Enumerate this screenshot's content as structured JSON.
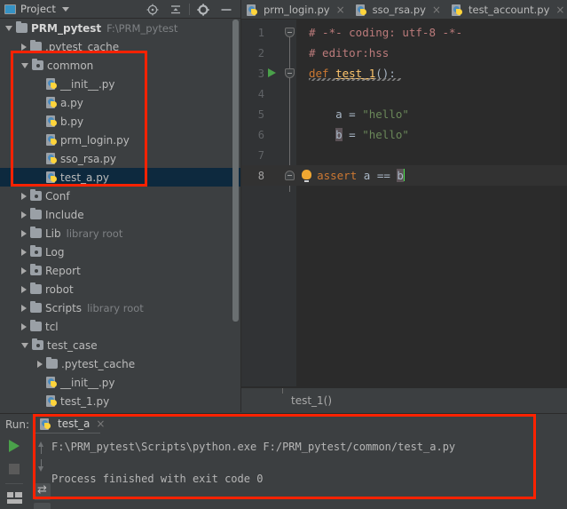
{
  "project_panel": {
    "title": "Project",
    "dropdown_icon": "chevron-down-icon",
    "tools": [
      "locate-icon",
      "collapse-all-icon",
      "settings-gear-icon",
      "minimize-icon"
    ],
    "tree": [
      {
        "depth": 0,
        "twist": "open",
        "icon": "folder",
        "label": "PRM_pytest",
        "sublabel": "F:\\PRM_pytest",
        "bold": true,
        "selected": false
      },
      {
        "depth": 1,
        "twist": "closed",
        "icon": "folder",
        "label": ".pytest_cache",
        "sublabel": "",
        "bold": false,
        "selected": false
      },
      {
        "depth": 1,
        "twist": "open",
        "icon": "folder-src",
        "label": "common",
        "sublabel": "",
        "bold": false,
        "selected": false
      },
      {
        "depth": 2,
        "twist": "none",
        "icon": "python-file",
        "label": "__init__.py",
        "sublabel": "",
        "bold": false,
        "selected": false
      },
      {
        "depth": 2,
        "twist": "none",
        "icon": "python-file",
        "label": "a.py",
        "sublabel": "",
        "bold": false,
        "selected": false
      },
      {
        "depth": 2,
        "twist": "none",
        "icon": "python-file",
        "label": "b.py",
        "sublabel": "",
        "bold": false,
        "selected": false
      },
      {
        "depth": 2,
        "twist": "none",
        "icon": "python-file",
        "label": "prm_login.py",
        "sublabel": "",
        "bold": false,
        "selected": false
      },
      {
        "depth": 2,
        "twist": "none",
        "icon": "python-file",
        "label": "sso_rsa.py",
        "sublabel": "",
        "bold": false,
        "selected": false
      },
      {
        "depth": 2,
        "twist": "none",
        "icon": "python-file",
        "label": "test_a.py",
        "sublabel": "",
        "bold": false,
        "selected": true
      },
      {
        "depth": 1,
        "twist": "closed",
        "icon": "folder-src",
        "label": "Conf",
        "sublabel": "",
        "bold": false,
        "selected": false
      },
      {
        "depth": 1,
        "twist": "closed",
        "icon": "folder",
        "label": "Include",
        "sublabel": "",
        "bold": false,
        "selected": false
      },
      {
        "depth": 1,
        "twist": "closed",
        "icon": "folder",
        "label": "Lib",
        "sublabel": "library root",
        "bold": false,
        "selected": false
      },
      {
        "depth": 1,
        "twist": "closed",
        "icon": "folder-src",
        "label": "Log",
        "sublabel": "",
        "bold": false,
        "selected": false
      },
      {
        "depth": 1,
        "twist": "closed",
        "icon": "folder-src",
        "label": "Report",
        "sublabel": "",
        "bold": false,
        "selected": false
      },
      {
        "depth": 1,
        "twist": "closed",
        "icon": "folder",
        "label": "robot",
        "sublabel": "",
        "bold": false,
        "selected": false
      },
      {
        "depth": 1,
        "twist": "closed",
        "icon": "folder",
        "label": "Scripts",
        "sublabel": "library root",
        "bold": false,
        "selected": false
      },
      {
        "depth": 1,
        "twist": "closed",
        "icon": "folder",
        "label": "tcl",
        "sublabel": "",
        "bold": false,
        "selected": false
      },
      {
        "depth": 1,
        "twist": "open",
        "icon": "folder-src",
        "label": "test_case",
        "sublabel": "",
        "bold": false,
        "selected": false
      },
      {
        "depth": 2,
        "twist": "closed",
        "icon": "folder",
        "label": ".pytest_cache",
        "sublabel": "",
        "bold": false,
        "selected": false
      },
      {
        "depth": 2,
        "twist": "none",
        "icon": "python-file",
        "label": "__init__.py",
        "sublabel": "",
        "bold": false,
        "selected": false
      },
      {
        "depth": 2,
        "twist": "none",
        "icon": "python-file",
        "label": "test_1.py",
        "sublabel": "",
        "bold": false,
        "selected": false
      }
    ]
  },
  "editor": {
    "tabs": [
      {
        "label": "prm_login.py",
        "icon": "python-file",
        "close": "×",
        "active": false
      },
      {
        "label": "sso_rsa.py",
        "icon": "python-file",
        "close": "×",
        "active": false
      },
      {
        "label": "test_account.py",
        "icon": "python-file",
        "close": "×",
        "active": false
      }
    ],
    "lines": [
      {
        "num": "1",
        "text": "# -*- coding: utf-8 -*-",
        "kind": "comment",
        "fold": "start",
        "runnable": false,
        "bulb": false,
        "current": false
      },
      {
        "num": "2",
        "text": "# editor:hss",
        "kind": "comment",
        "fold": "mid",
        "runnable": false,
        "bulb": false,
        "current": false
      },
      {
        "num": "3",
        "text": "def test_1():",
        "kind": "def",
        "fold": "start",
        "runnable": true,
        "bulb": false,
        "current": false
      },
      {
        "num": "4",
        "text": "",
        "kind": "plain",
        "fold": "none",
        "runnable": false,
        "bulb": false,
        "current": false
      },
      {
        "num": "5",
        "text": "    a = \"hello\"",
        "kind": "assign_a",
        "fold": "none",
        "runnable": false,
        "bulb": false,
        "current": false
      },
      {
        "num": "6",
        "text": "    b = \"hello\"",
        "kind": "assign_b",
        "fold": "none",
        "runnable": false,
        "bulb": false,
        "current": false
      },
      {
        "num": "7",
        "text": "",
        "kind": "plain",
        "fold": "none",
        "runnable": false,
        "bulb": false,
        "current": false
      },
      {
        "num": "8",
        "text": "    assert a == b",
        "kind": "assert",
        "fold": "end",
        "runnable": false,
        "bulb": true,
        "current": true
      }
    ],
    "code_tokens": {
      "comment1": "# -*- coding: utf-8 -*-",
      "comment2": "# editor:hss",
      "kw_def": "def",
      "fn_name": "test_1",
      "fn_parens": "():",
      "var_a": "a",
      "var_b": "b",
      "eq": "=",
      "str_hello": "\"hello\"",
      "kw_assert": "assert",
      "op_eqeq": "=="
    },
    "breadcrumb": "test_1()"
  },
  "run_panel": {
    "label": "Run:",
    "tab": {
      "label": "test_a",
      "icon": "python-file",
      "close": "×"
    },
    "sidebar_icons": [
      "run-icon",
      "stop-icon",
      "layout-icon"
    ],
    "gutter_icons": [
      "scroll-up-icon",
      "scroll-down-icon",
      "soft-wrap-icon",
      "print-icon"
    ],
    "output": [
      "F:\\PRM_pytest\\Scripts\\python.exe F:/PRM_pytest/common/test_a.py",
      "",
      "Process finished with exit code 0"
    ]
  },
  "annotations": {
    "color": "#ff2200",
    "boxes": [
      "common-folder-highlight",
      "run-output-highlight"
    ]
  }
}
